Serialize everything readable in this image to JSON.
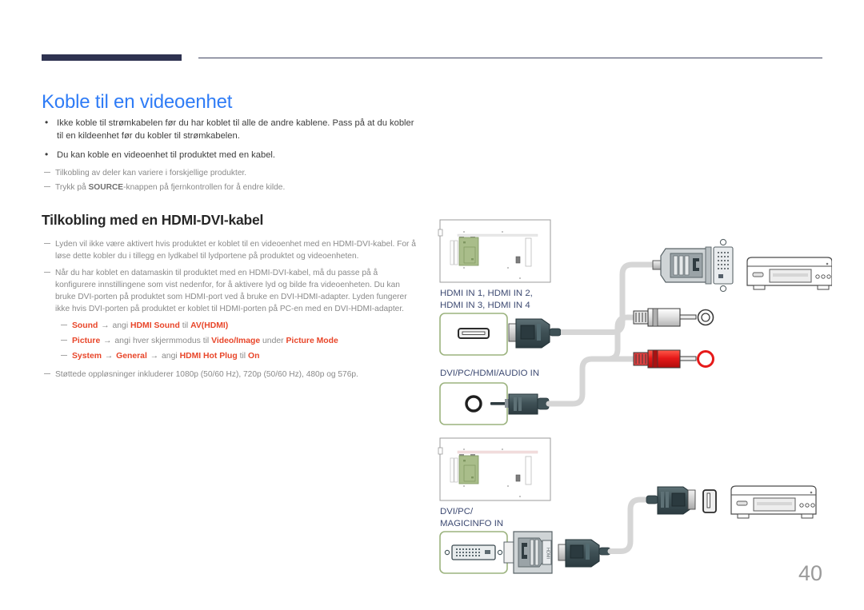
{
  "header": {
    "accent_color": "#2e3250",
    "rule_color": "#3f4460"
  },
  "page_title": "Koble til en videoenhet",
  "title_color": "#2f7cf6",
  "bullets": [
    "Ikke koble til strømkabelen før du har koblet til alle de andre kablene. Pass på at du kobler til en kildeenhet før du kobler til strømkabelen.",
    "Du kan koble en videoenhet til produktet med en kabel."
  ],
  "intro_notes": [
    {
      "pre": "Tilkobling av deler kan variere i forskjellige produkter.",
      "bold": "",
      "post": ""
    },
    {
      "pre": "Trykk på ",
      "bold": "SOURCE",
      "post": "-knappen på fjernkontrollen for å endre kilde."
    }
  ],
  "sub_title": "Tilkobling med en HDMI-DVI-kabel",
  "body_notes": [
    "Lyden vil ikke være aktivert hvis produktet er koblet til en videoenhet med en HDMI-DVI-kabel. For å løse dette kobler du i tillegg en lydkabel til lydportene på produktet og videoenheten.",
    "Når du har koblet en datamaskin til produktet med en HDMI-DVI-kabel, må du passe på å konfigurere innstillingene som vist nedenfor, for å aktivere lyd og bilde fra videoenheten. Du kan bruke DVI-porten på produktet som HDMI-port ved å bruke en DVI-HDMI-adapter. Lyden fungerer ikke hvis DVI-porten på produktet er koblet til HDMI-porten på PC-en med en DVI-HDMI-adapter."
  ],
  "settings_rows": [
    [
      {
        "t": "Sound",
        "s": "hl"
      },
      {
        "t": " → ",
        "s": "arrow"
      },
      {
        "t": "angi ",
        "s": ""
      },
      {
        "t": "HDMI Sound",
        "s": "hl"
      },
      {
        "t": " til ",
        "s": ""
      },
      {
        "t": "AV(HDMI)",
        "s": "hl"
      }
    ],
    [
      {
        "t": "Picture",
        "s": "hl"
      },
      {
        "t": " → ",
        "s": "arrow"
      },
      {
        "t": "angi hver skjermmodus til ",
        "s": ""
      },
      {
        "t": "Video/Image",
        "s": "hl"
      },
      {
        "t": " under ",
        "s": ""
      },
      {
        "t": "Picture Mode",
        "s": "hl"
      }
    ],
    [
      {
        "t": "System",
        "s": "hl"
      },
      {
        "t": " → ",
        "s": "arrow"
      },
      {
        "t": "General",
        "s": "hl"
      },
      {
        "t": " → ",
        "s": "arrow"
      },
      {
        "t": "angi ",
        "s": ""
      },
      {
        "t": "HDMI Hot Plug",
        "s": "hl"
      },
      {
        "t": " til ",
        "s": ""
      },
      {
        "t": "On",
        "s": "hl"
      }
    ]
  ],
  "closing_note": "Støttede oppløsninger inkluderer 1080p (50/60 Hz), 720p (50/60 Hz), 480p og 576p.",
  "diagram": {
    "label_color": "#3d4a72",
    "port_border_color": "#9cb37f",
    "cable_color": "#d6d6d6",
    "connector_color": "#3f5156",
    "rca_red": "#e61919",
    "rca_white": "#d9d9d9",
    "labels": {
      "hdmi_in": "HDMI IN 1, HDMI IN 2,\nHDMI IN 3, HDMI IN 4",
      "hdmi_in_line1": "HDMI IN 1, HDMI IN 2,",
      "hdmi_in_line2": "HDMI IN 3, HDMI IN 4",
      "audio_in": "DVI/PC/HDMI/AUDIO IN",
      "dvi_pc_line1": "DVI/PC/",
      "dvi_pc_line2": "MAGICINFO IN"
    }
  },
  "page_number": "40"
}
